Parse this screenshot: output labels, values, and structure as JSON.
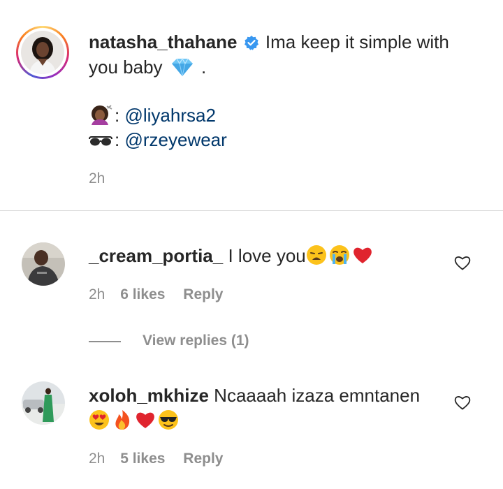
{
  "caption": {
    "username": "natasha_thahane",
    "text_line1": "Ima keep it simple with",
    "text_line2": "you baby",
    "text_line2_end": ".",
    "credit1_mention": "@liyahrsa2",
    "credit2_mention": "@rzeyewear",
    "credit_separator": ":",
    "time": "2h",
    "icons": [
      "verified-badge-icon",
      "gem-emoji",
      "haircut-emoji",
      "glasses-emoji"
    ],
    "colors": {
      "verified": "#3897f0",
      "mention": "#00376b"
    }
  },
  "comments": [
    {
      "username": "_cream_portia_",
      "text": "I love you",
      "emojis": [
        "weary-face-emoji",
        "crying-face-emoji",
        "red-heart-emoji"
      ],
      "time": "2h",
      "likes": "6 likes",
      "reply": "Reply",
      "view_replies": "View replies (1)"
    },
    {
      "username": "xoloh_mkhize",
      "text": "Ncaaaah izaza emntanen",
      "emojis": [
        "heart-eyes-emoji",
        "fire-emoji",
        "red-heart-emoji",
        "sunglasses-face-emoji"
      ],
      "time": "2h",
      "likes": "5 likes",
      "reply": "Reply"
    }
  ],
  "colors": {
    "text": "#262626",
    "secondary": "#8e8e8e",
    "divider": "#dbdbdb"
  }
}
